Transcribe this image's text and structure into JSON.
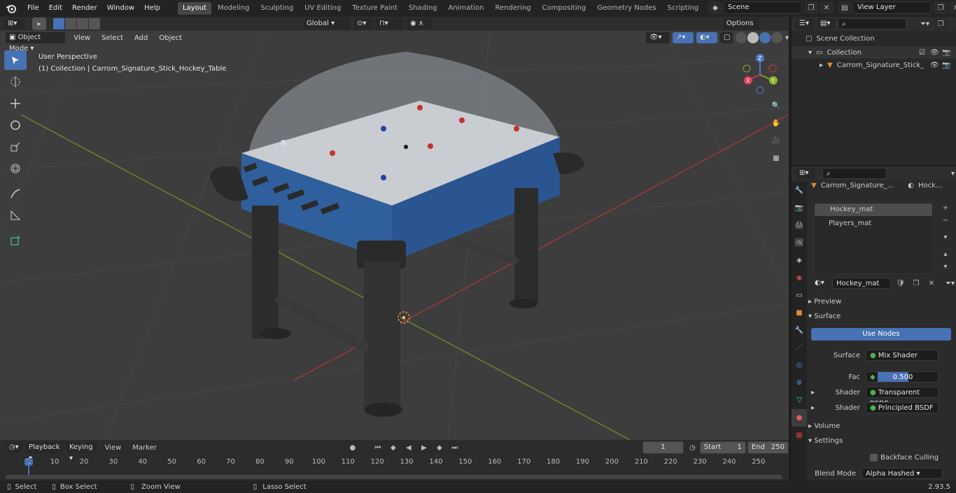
{
  "menu": [
    "File",
    "Edit",
    "Render",
    "Window",
    "Help"
  ],
  "workspaces": [
    "Layout",
    "Modeling",
    "Sculpting",
    "UV Editing",
    "Texture Paint",
    "Shading",
    "Animation",
    "Rendering",
    "Compositing",
    "Geometry Nodes",
    "Scripting"
  ],
  "active_workspace": "Layout",
  "scene_name": "Scene",
  "view_layer": "View Layer",
  "viewport": {
    "transform": "Global",
    "options": "Options",
    "mode": "Object Mode",
    "menus": [
      "View",
      "Select",
      "Add",
      "Object"
    ],
    "perspective": "User Perspective",
    "collection_info": "(1) Collection | Carrom_Signature_Stick_Hockey_Table",
    "gizmo": {
      "x": "X",
      "y": "Y",
      "z": "Z"
    }
  },
  "outliner": {
    "scene_collection": "Scene Collection",
    "collection": "Collection",
    "object": "Carrom_Signature_Stick_"
  },
  "properties": {
    "object_name": "Carrom_Signature_...",
    "material_short": "Hock...",
    "slots": [
      "Hockey_mat",
      "Players_mat"
    ],
    "material": "Hockey_mat",
    "preview": "Preview",
    "surface_panel": "Surface",
    "use_nodes": "Use Nodes",
    "surface_label": "Surface",
    "surface_value": "Mix Shader",
    "fac_label": "Fac",
    "fac_value": "0.500",
    "fac_fraction": 0.5,
    "shader_label": "Shader",
    "shader1": "Transparent BSDF",
    "shader2": "Principled BSDF",
    "volume": "Volume",
    "settings": "Settings",
    "backface": "Backface Culling",
    "blend_label": "Blend Mode",
    "blend_value": "Alpha Hashed"
  },
  "timeline": {
    "menus": [
      "Playback",
      "Keying",
      "View",
      "Marker"
    ],
    "current": "1",
    "start_label": "Start",
    "start": "1",
    "end_label": "End",
    "end": "250",
    "ticks": [
      "1",
      "10",
      "20",
      "30",
      "40",
      "50",
      "60",
      "70",
      "80",
      "90",
      "100",
      "110",
      "120",
      "130",
      "140",
      "150",
      "160",
      "170",
      "180",
      "190",
      "200",
      "210",
      "220",
      "230",
      "240",
      "250"
    ]
  },
  "status": {
    "select": "Select",
    "box_select": "Box Select",
    "zoom": "Zoom View",
    "lasso": "Lasso Select",
    "version": "2.93.5"
  },
  "colors": {
    "accent": "#4772b3",
    "table_blue": "#2f5f9c"
  }
}
